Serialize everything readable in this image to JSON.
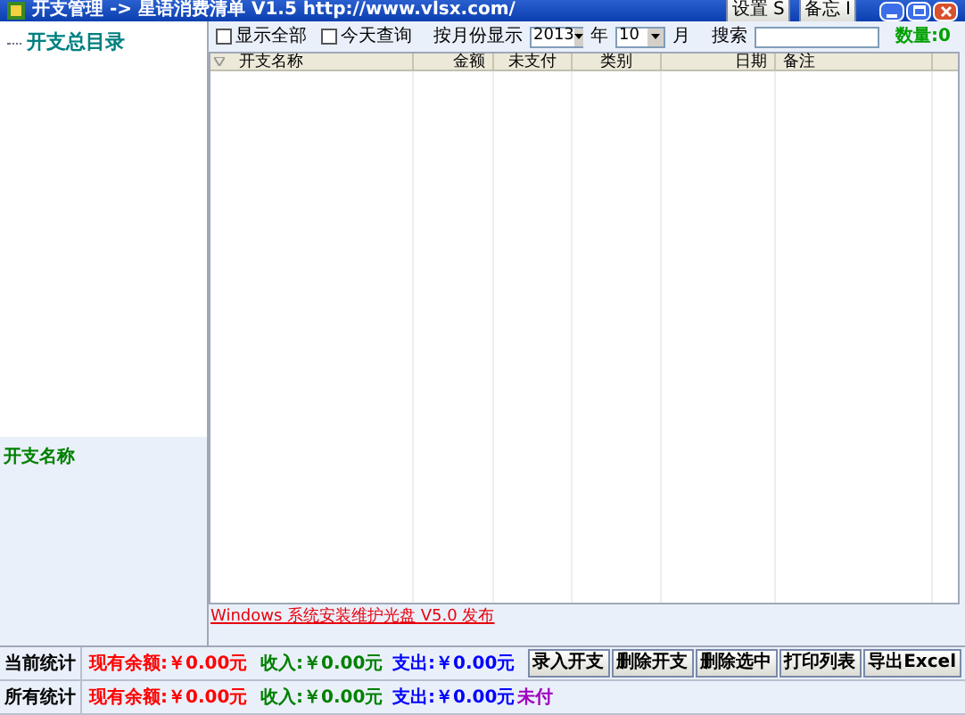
{
  "window": {
    "title": "开支管理 -> 星语消费清单 V1.5 http://www.vlsx.com/",
    "buttons": [
      "设置 S",
      "备忘 I"
    ]
  },
  "sidebar": {
    "tree": [
      {
        "label": "开支总目录",
        "selected": false
      }
    ],
    "detail_label": "开支名称"
  },
  "toolbar": {
    "checkboxes": [
      {
        "label": "显示全部",
        "checked": false
      },
      {
        "label": "今天查询",
        "checked": false
      }
    ],
    "month_label": "按月份显示",
    "year": "2013",
    "year_unit": "年",
    "month": "10",
    "month_unit": "月",
    "search_label": "搜索",
    "count": "数量:0"
  },
  "table": {
    "columns": [
      "开支名称",
      "金额",
      "未支付",
      "类别",
      "日期",
      "备注"
    ]
  },
  "link": "Windows 系统安装维护光盘 V5.0 发布",
  "stats": [
    {
      "label": "当前统计",
      "balance": "现有余额:￥0.00元",
      "income": "收入:￥0.00元",
      "expense": "支出:￥0.00元"
    },
    {
      "label": "所有统计",
      "balance": "现有余额:￥0.00元",
      "income": "收入:￥0.00元",
      "expense": "支出:￥0.00元",
      "unpaid": "未付"
    }
  ],
  "buttons": [
    "录入开支",
    "删除开支",
    "删除选中",
    "打印列表",
    "导出Excel"
  ]
}
